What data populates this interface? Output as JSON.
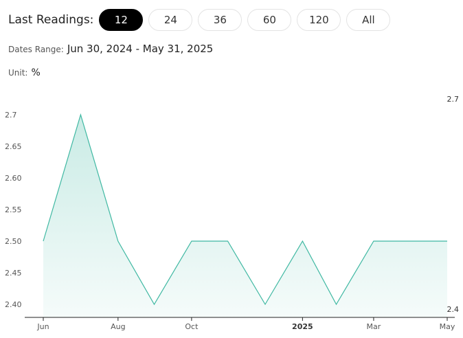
{
  "readings": {
    "label": "Last Readings:",
    "options": [
      "12",
      "24",
      "36",
      "60",
      "120",
      "All"
    ],
    "active": "12"
  },
  "dates_range": {
    "label": "Dates Range:",
    "value": "Jun 30, 2024 - May 31, 2025"
  },
  "unit": {
    "label": "Unit:",
    "value": "%"
  },
  "chart_data": {
    "type": "area",
    "title": "",
    "xlabel": "",
    "ylabel": "",
    "x": [
      "2024-06-30",
      "2024-07-31",
      "2024-08-31",
      "2024-09-30",
      "2024-10-31",
      "2024-11-30",
      "2024-12-31",
      "2025-01-31",
      "2025-02-28",
      "2025-03-31",
      "2025-04-30",
      "2025-05-31"
    ],
    "values": [
      2.5,
      2.7,
      2.5,
      2.4,
      2.5,
      2.5,
      2.4,
      2.5,
      2.4,
      2.5,
      2.5,
      2.5
    ],
    "ylim": [
      2.4,
      2.7
    ],
    "y_ticks": [
      "2.40",
      "2.45",
      "2.50",
      "2.55",
      "2.60",
      "2.65",
      "2.7"
    ],
    "x_ticks": [
      {
        "date": "2024-06-30",
        "label": "Jun",
        "bold": false
      },
      {
        "date": "2024-08-31",
        "label": "Aug",
        "bold": false
      },
      {
        "date": "2024-10-31",
        "label": "Oct",
        "bold": false
      },
      {
        "date": "2025-01-31",
        "label": "2025",
        "bold": true
      },
      {
        "date": "2025-03-31",
        "label": "Mar",
        "bold": false
      },
      {
        "date": "2025-05-31",
        "label": "May",
        "bold": false
      }
    ],
    "max_label": "2.7",
    "min_label": "2.4",
    "grid": false,
    "line_color": "#3fb8a2",
    "fill_color": "#3fb8a2"
  }
}
